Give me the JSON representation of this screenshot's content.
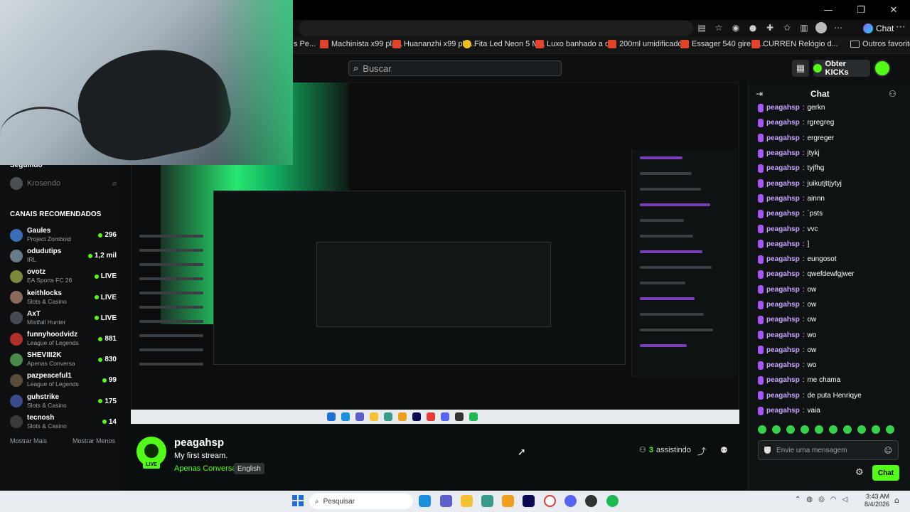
{
  "browser": {
    "bookmarks": [
      {
        "label": "s Pe...",
        "fav": "red"
      },
      {
        "label": "Machinista x99 pla...",
        "fav": "red"
      },
      {
        "label": "Huananzhi x99 pla...",
        "fav": "red"
      },
      {
        "label": "Fita Led Neon 5 M...",
        "fav": "yellow"
      },
      {
        "label": "Luxo banhado a o...",
        "fav": "red"
      },
      {
        "label": "200ml umidificado...",
        "fav": "red"
      },
      {
        "label": "Essager 540 gire o...",
        "fav": "red"
      },
      {
        "label": "CURREN Relógio d...",
        "fav": "red"
      }
    ],
    "other_favorites": "Outros favoritos",
    "chat_button": "Chat"
  },
  "header": {
    "search_placeholder": "Buscar",
    "get_kicks": "Obter KICKs"
  },
  "sidebar": {
    "following_title": "Seguindo",
    "following": [
      {
        "name": "Krosendo"
      }
    ],
    "recommended_title": "CANAIS RECOMENDADOS",
    "channels": [
      {
        "name": "Gaules",
        "category": "Project Zomboid",
        "viewers": "296",
        "color": "#3b6fb5"
      },
      {
        "name": "odudutips",
        "category": "IRL",
        "viewers": "1,2 mil",
        "color": "#6a7b8c"
      },
      {
        "name": "ovotz",
        "category": "EA Sports FC 26",
        "viewers": "LIVE",
        "color": "#7a8a3a"
      },
      {
        "name": "keithlocks",
        "category": "Slots & Casino",
        "viewers": "LIVE",
        "color": "#8a6a5a"
      },
      {
        "name": "AxT",
        "category": "Mistfall Hunter",
        "viewers": "LIVE",
        "color": "#444b52"
      },
      {
        "name": "funnyhoodvidz",
        "category": "League of Legends",
        "viewers": "881",
        "color": "#b0302a"
      },
      {
        "name": "SHEVIII2K",
        "category": "Apenas Conversa",
        "viewers": "830",
        "color": "#4a8a4a"
      },
      {
        "name": "pazpeaceful1",
        "category": "League of Legends",
        "viewers": "99",
        "color": "#5a4a3a"
      },
      {
        "name": "guhstrike",
        "category": "Slots & Casino",
        "viewers": "175",
        "color": "#3a4a8a"
      },
      {
        "name": "tecnosh",
        "category": "Slots & Casino",
        "viewers": "14",
        "color": "#3a3a3a"
      }
    ],
    "show_more": "Mostrar Mais",
    "show_less": "Mostrar Menos"
  },
  "stream": {
    "streamer": "peagahsp",
    "title": "My first stream.",
    "category": "Apenas Conversa",
    "language": "English",
    "live_badge": "LIVE",
    "viewers_count": "3",
    "viewers_label": "assistindo"
  },
  "chat": {
    "title": "Chat",
    "messages": [
      {
        "user": "peagahsp",
        "text": "gerkn"
      },
      {
        "user": "peagahsp",
        "text": "rgregreg"
      },
      {
        "user": "peagahsp",
        "text": "ergreger"
      },
      {
        "user": "peagahsp",
        "text": "jtykj"
      },
      {
        "user": "peagahsp",
        "text": "tyjfhg"
      },
      {
        "user": "peagahsp",
        "text": "juikutjttjytyj"
      },
      {
        "user": "peagahsp",
        "text": "ainnn"
      },
      {
        "user": "peagahsp",
        "text": "´psts"
      },
      {
        "user": "peagahsp",
        "text": "vvc"
      },
      {
        "user": "peagahsp",
        "text": "]"
      },
      {
        "user": "peagahsp",
        "text": "eungosot"
      },
      {
        "user": "peagahsp",
        "text": "qwefdewfgjwer"
      },
      {
        "user": "peagahsp",
        "text": "ow"
      },
      {
        "user": "peagahsp",
        "text": "ow"
      },
      {
        "user": "peagahsp",
        "text": "ow"
      },
      {
        "user": "peagahsp",
        "text": "wo"
      },
      {
        "user": "peagahsp",
        "text": "ow"
      },
      {
        "user": "peagahsp",
        "text": "wo"
      },
      {
        "user": "peagahsp",
        "text": "me chama"
      },
      {
        "user": "peagahsp",
        "text": "de puta Henriqye"
      },
      {
        "user": "peagahsp",
        "text": "vaia"
      }
    ],
    "input_placeholder": "Envie uma mensagem",
    "send_label": "Chat"
  },
  "taskbar": {
    "search_label": "Pesquisar",
    "time": "3:43 AM",
    "date": "8/4/2026"
  },
  "colors": {
    "accent": "#53fc18",
    "chat_username": "#c7a4ff"
  }
}
